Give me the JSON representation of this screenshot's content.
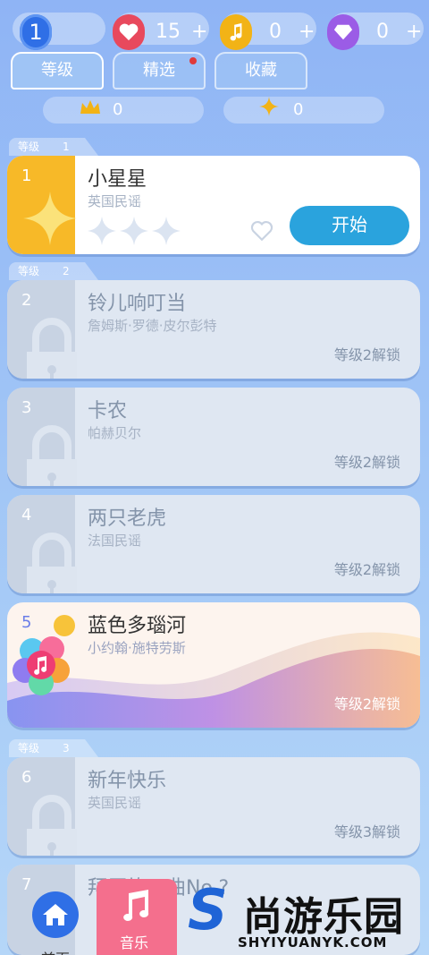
{
  "topbar": {
    "level": "1",
    "hearts": "15",
    "notes": "0",
    "diamonds": "0",
    "plus": "+"
  },
  "tabs": [
    {
      "label": "等级",
      "active": true
    },
    {
      "label": "精选",
      "has_dot": true
    },
    {
      "label": "收藏"
    }
  ],
  "stats": {
    "crowns": "0",
    "stars": "0"
  },
  "sections": [
    {
      "label": "等级",
      "num": "1"
    },
    {
      "label": "等级",
      "num": "2"
    },
    {
      "label": "等级",
      "num": "3"
    }
  ],
  "songs": [
    {
      "num": "1",
      "title": "小星星",
      "subtitle": "英国民谣",
      "button": "开始"
    },
    {
      "num": "2",
      "title": "铃儿响叮当",
      "subtitle": "詹姆斯·罗德·皮尔彭特",
      "status": "等级2解锁"
    },
    {
      "num": "3",
      "title": "卡农",
      "subtitle": "帕赫贝尔",
      "status": "等级2解锁"
    },
    {
      "num": "4",
      "title": "两只老虎",
      "subtitle": "法国民谣",
      "status": "等级2解锁"
    },
    {
      "num": "5",
      "title": "蓝色多瑙河",
      "subtitle": "小约翰·施特劳斯",
      "status": "等级2解锁"
    },
    {
      "num": "6",
      "title": "新年快乐",
      "subtitle": "英国民谣",
      "status": "等级3解锁"
    },
    {
      "num": "7",
      "title": "拜厄练习曲No.?"
    }
  ],
  "nav": {
    "home": "首页",
    "music": "音乐"
  },
  "brand": {
    "name": "尚游乐园",
    "url": "SHYIYUANYK.COM"
  }
}
